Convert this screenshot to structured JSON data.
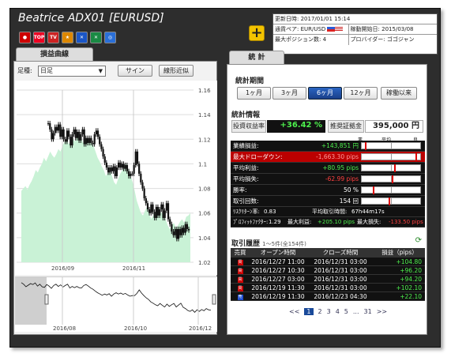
{
  "header": {
    "title": "Beatrice ADX01 [EURUSD]",
    "icons": [
      "jp-icon",
      "top100-icon",
      "tv-icon",
      "award-icon",
      "chart-icon",
      "award2-icon",
      "globe-icon"
    ],
    "plus_label": "+"
  },
  "info": {
    "updated_label": "更新日時:",
    "updated_value": "2017/01/01 15:14",
    "pair_label": "通貨ペア:",
    "pair_value": "EUR/USD",
    "start_label": "稼動開始日:",
    "start_value": "2015/03/08",
    "maxpos_label": "最大ポジション数:",
    "maxpos_value": "4",
    "provider_label": "プロバイダー:",
    "provider_value": "ゴゴジャン"
  },
  "left": {
    "tab": "損益曲線",
    "foot_label": "足種:",
    "foot_value": "日足",
    "btn_sine": "サイン",
    "btn_linear": "線形近似",
    "chart_data": {
      "type": "line",
      "yticks": [
        "1.16",
        "1.14",
        "1.12",
        "1.1",
        "1.08",
        "1.06",
        "1.04",
        "1.02"
      ],
      "xticks": [
        "2016/09",
        "2016/11"
      ],
      "nav_xticks": [
        "2016/08",
        "2016/10",
        "2016/12"
      ],
      "ylim": [
        1.02,
        1.16
      ],
      "price": [
        1.133,
        1.128,
        1.12,
        1.125,
        1.13,
        1.127,
        1.132,
        1.122,
        1.128,
        1.12,
        1.118,
        1.127,
        1.122,
        1.115,
        1.124,
        1.128,
        1.121,
        1.126,
        1.119,
        1.124,
        1.128,
        1.116,
        1.121,
        1.117,
        1.121,
        1.117,
        1.116,
        1.124,
        1.127,
        1.122,
        1.116,
        1.112,
        1.106,
        1.101,
        1.097,
        1.093,
        1.097,
        1.094,
        1.098,
        1.09,
        1.097,
        1.101,
        1.097,
        1.1,
        1.096,
        1.099,
        1.094,
        1.09,
        1.092,
        1.092,
        1.099,
        1.11,
        1.1,
        1.092,
        1.085,
        1.08,
        1.072,
        1.068,
        1.063,
        1.06,
        1.067,
        1.061,
        1.056,
        1.065,
        1.058,
        1.063,
        1.067,
        1.056,
        1.062,
        1.068,
        1.055,
        1.051,
        1.045,
        1.042,
        1.047,
        1.039,
        1.047,
        1.042,
        1.048,
        1.044,
        1.051,
        1.047,
        1.046
      ],
      "equity": [
        1.078,
        1.08,
        1.082,
        1.079,
        1.083,
        1.086,
        1.09,
        1.095,
        1.093,
        1.097,
        1.1,
        1.105,
        1.102,
        1.106,
        1.11,
        1.107,
        1.105,
        1.108,
        1.112,
        1.11,
        1.115,
        1.118,
        1.12,
        1.116,
        1.119,
        1.121,
        1.118,
        1.122,
        1.125,
        1.121,
        1.117,
        1.12,
        1.118,
        1.12,
        1.117,
        1.115,
        1.11,
        1.105,
        1.102,
        1.098,
        1.095,
        1.09,
        1.093,
        1.096,
        1.09,
        1.085,
        1.083,
        1.088,
        1.092,
        1.095,
        1.098,
        1.1,
        1.095,
        1.09,
        1.085,
        1.078,
        1.07,
        1.065,
        1.06,
        1.058,
        1.062,
        1.065,
        1.06,
        1.055,
        1.058,
        1.06,
        1.065,
        1.063,
        1.06,
        1.058,
        1.055,
        1.05,
        1.047,
        1.05,
        1.052,
        1.048,
        1.05,
        1.053,
        1.055,
        1.052,
        1.057,
        1.058,
        1.06
      ]
    }
  },
  "right": {
    "tab": "統 計",
    "period_heading": "統計期間",
    "periods": [
      "1ヶ月",
      "3ヶ月",
      "6ヶ月",
      "12ヶ月",
      "稼働以来"
    ],
    "stats_heading": "統計情報",
    "roi_label": "投資収益率",
    "roi_value": "+36.42 %",
    "margin_label": "推奨証拠金",
    "margin_value": "395,000 円",
    "scale": [
      "悪",
      "平均",
      "良"
    ],
    "rows": [
      {
        "label": "業績損益:",
        "value": "+143,851 円",
        "cls": "green",
        "pos": 0.06
      },
      {
        "label": "最大ドローダウン:",
        "value": "-1,663.30 pips",
        "cls": "red",
        "pos": 0.9
      },
      {
        "label": "平均利益:",
        "value": "+80.95 pips",
        "cls": "green",
        "pos": 0.55
      },
      {
        "label": "平均損失:",
        "value": "-62.99 pips",
        "cls": "red",
        "pos": 0.5
      },
      {
        "label": "勝率:",
        "value": "50 %",
        "cls": "",
        "pos": 0.18
      },
      {
        "label": "取引回数:",
        "value": "154 回",
        "cls": "",
        "pos": 0.45
      }
    ],
    "ri_label": "ﾘｽｸﾘﾀｰﾝ率:",
    "ri_value": "0.83",
    "avg_hold_label": "平均取引時間:",
    "avg_hold_value": "67h44m17s",
    "pf_label": "ﾌﾟﾛﾌｨｯﾄﾌｧｸﾀｰ:",
    "pf_value": "1.29",
    "maxprofit_label": "最大利益:",
    "maxprofit_value": "+205.10 pips",
    "maxloss_label": "最大損失:",
    "maxloss_value": "-133.50 pips",
    "history_heading": "取引履歴",
    "history_count": "1～5件(全154件)",
    "history_cols": [
      "売買",
      "オープン時間",
      "クローズ時間",
      "損益（pips）"
    ],
    "history": [
      {
        "side": "買",
        "open": "2016/12/27 11:00",
        "close": "2016/12/31 03:00",
        "pips": "+104.80"
      },
      {
        "side": "買",
        "open": "2016/12/27 10:30",
        "close": "2016/12/31 03:00",
        "pips": "+96.20"
      },
      {
        "side": "買",
        "open": "2016/12/27 03:00",
        "close": "2016/12/31 03:00",
        "pips": "+94.20"
      },
      {
        "side": "買",
        "open": "2016/12/19 11:30",
        "close": "2016/12/31 03:00",
        "pips": "+102.10"
      },
      {
        "side": "売",
        "open": "2016/12/19 11:30",
        "close": "2016/12/23 04:30",
        "pips": "+22.10"
      }
    ],
    "pager": [
      "<<",
      "1",
      "2",
      "3",
      "4",
      "5",
      "...",
      "31",
      ">>"
    ]
  }
}
